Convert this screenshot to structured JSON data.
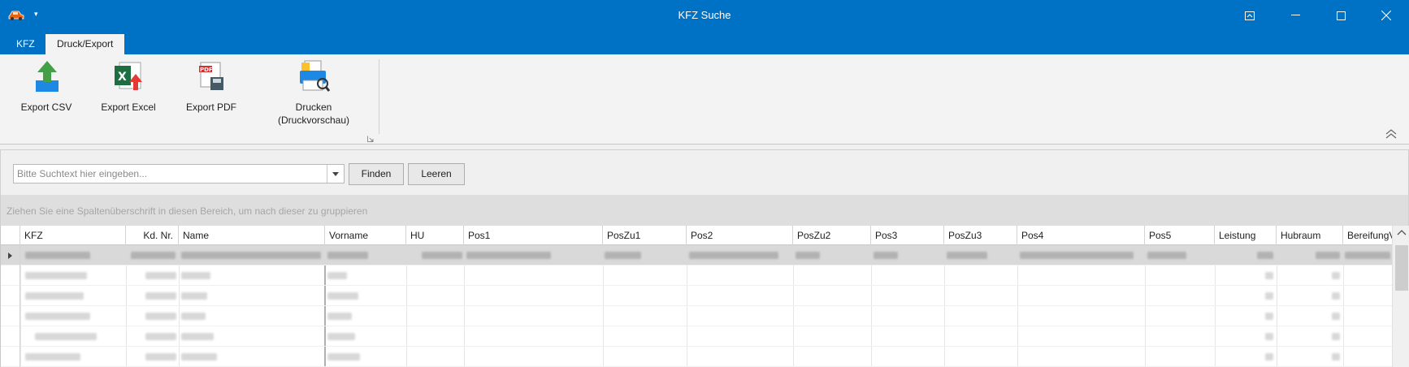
{
  "window": {
    "title": "KFZ Suche",
    "app_icon": "car-icon",
    "qat_arrow": "▾",
    "controls": [
      "restore-ribbon-icon",
      "minimize-icon",
      "maximize-icon",
      "close-icon"
    ]
  },
  "ribbon": {
    "tabs": [
      {
        "label": "KFZ",
        "active": false
      },
      {
        "label": "Druck/Export",
        "active": true
      }
    ],
    "buttons": [
      {
        "label": "Export CSV",
        "icon": "export-csv-icon"
      },
      {
        "label": "Export Excel",
        "icon": "export-excel-icon"
      },
      {
        "label": "Export PDF",
        "icon": "export-pdf-icon"
      },
      {
        "label_line1": "Drucken",
        "label_line2": "(Druckvorschau)",
        "icon": "print-preview-icon"
      }
    ]
  },
  "search": {
    "placeholder": "Bitte Suchtext hier eingeben...",
    "value": "",
    "find_label": "Finden",
    "clear_label": "Leeren"
  },
  "grid": {
    "group_hint": "Ziehen Sie eine Spaltenüberschrift in diesen Bereich, um nach dieser zu gruppieren",
    "columns": [
      "KFZ",
      "Kd. Nr.",
      "Name",
      "Vorname",
      "HU",
      "Pos1",
      "PosZu1",
      "Pos2",
      "PosZu2",
      "Pos3",
      "PosZu3",
      "Pos4",
      "Pos5",
      "Leistung",
      "Hubraum",
      "BereifungVorn"
    ],
    "visible_rows": 6,
    "selected_row": 0
  },
  "colors": {
    "titlebar": "#0072c6",
    "ribbon_bg": "#f3f3f3",
    "selected_row": "#d9d9d9"
  }
}
